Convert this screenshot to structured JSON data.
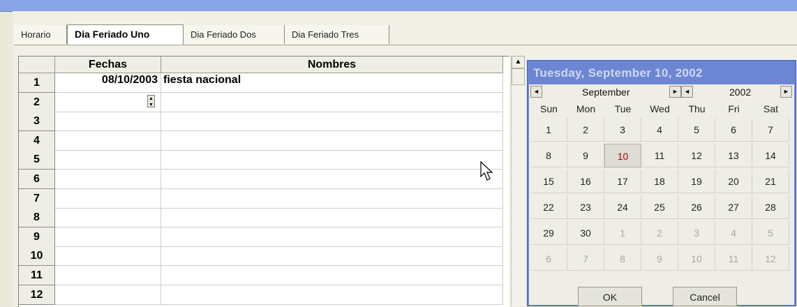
{
  "tabs": [
    {
      "label": "Horario"
    },
    {
      "label": "Dia Feriado Uno"
    },
    {
      "label": "Dia Feriado Dos"
    },
    {
      "label": "Dia Feriado Tres"
    }
  ],
  "grid": {
    "columns": [
      "Fechas",
      "Nombres"
    ],
    "rows": [
      {
        "num": "1",
        "fecha": "08/10/2003",
        "nombre": "fiesta nacional"
      },
      {
        "num": "2",
        "fecha": "",
        "nombre": ""
      },
      {
        "num": "3",
        "fecha": "",
        "nombre": ""
      },
      {
        "num": "4",
        "fecha": "",
        "nombre": ""
      },
      {
        "num": "5",
        "fecha": "",
        "nombre": ""
      },
      {
        "num": "6",
        "fecha": "",
        "nombre": ""
      },
      {
        "num": "7",
        "fecha": "",
        "nombre": ""
      },
      {
        "num": "8",
        "fecha": "",
        "nombre": ""
      },
      {
        "num": "9",
        "fecha": "",
        "nombre": ""
      },
      {
        "num": "10",
        "fecha": "",
        "nombre": ""
      },
      {
        "num": "11",
        "fecha": "",
        "nombre": ""
      },
      {
        "num": "12",
        "fecha": "",
        "nombre": ""
      }
    ]
  },
  "calendar": {
    "title": "Tuesday, September 10, 2002",
    "month": "September",
    "year": "2002",
    "weekdays": [
      "Sun",
      "Mon",
      "Tue",
      "Wed",
      "Thu",
      "Fri",
      "Sat"
    ],
    "days": [
      "1",
      "2",
      "3",
      "4",
      "5",
      "6",
      "7",
      "8",
      "9",
      "10",
      "11",
      "12",
      "13",
      "14",
      "15",
      "16",
      "17",
      "18",
      "19",
      "20",
      "21",
      "22",
      "23",
      "24",
      "25",
      "26",
      "27",
      "28",
      "29",
      "30",
      "1",
      "2",
      "3",
      "4",
      "5",
      "6",
      "7",
      "8",
      "9",
      "10",
      "11",
      "12"
    ],
    "selected_index": 9,
    "current_month_count": 30,
    "ok_label": "OK",
    "cancel_label": "Cancel"
  },
  "icons": {
    "nav_left": "◄",
    "nav_right": "►",
    "scroll_up": "▲",
    "spin": "▲▼"
  }
}
